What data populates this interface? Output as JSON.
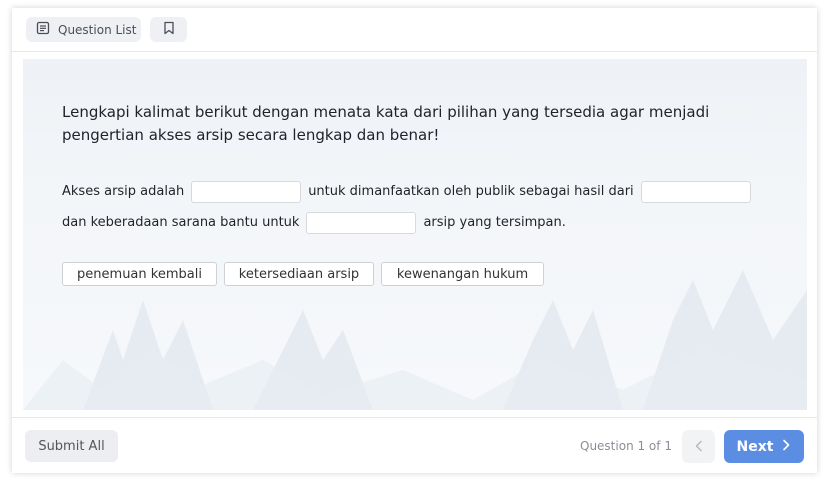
{
  "topbar": {
    "question_list_label": "Question List",
    "question_list_icon": "list-document-icon",
    "bookmark_icon": "bookmark-icon"
  },
  "question": {
    "prompt": "Lengkapi kalimat berikut dengan menata kata dari pilihan yang tersedia agar menjadi pengertian akses arsip secara lengkap dan benar!",
    "sentence": {
      "part1": "Akses arsip adalah",
      "part2": "untuk dimanfaatkan oleh publik sebagai hasil dari",
      "part3": "dan keberadaan sarana bantu untuk",
      "part4": "arsip yang tersimpan."
    },
    "blanks": [
      "",
      "",
      ""
    ],
    "options": [
      "penemuan kembali",
      "ketersediaan arsip",
      "kewenangan hukum"
    ]
  },
  "footer": {
    "submit_label": "Submit All",
    "question_counter": "Question 1 of 1",
    "next_label": "Next",
    "prev_icon": "chevron-left-icon",
    "next_icon": "chevron-right-icon"
  },
  "colors": {
    "accent": "#5b8ee3",
    "content_bg": "#eef2f6",
    "pill_bg": "#eef0f3"
  }
}
